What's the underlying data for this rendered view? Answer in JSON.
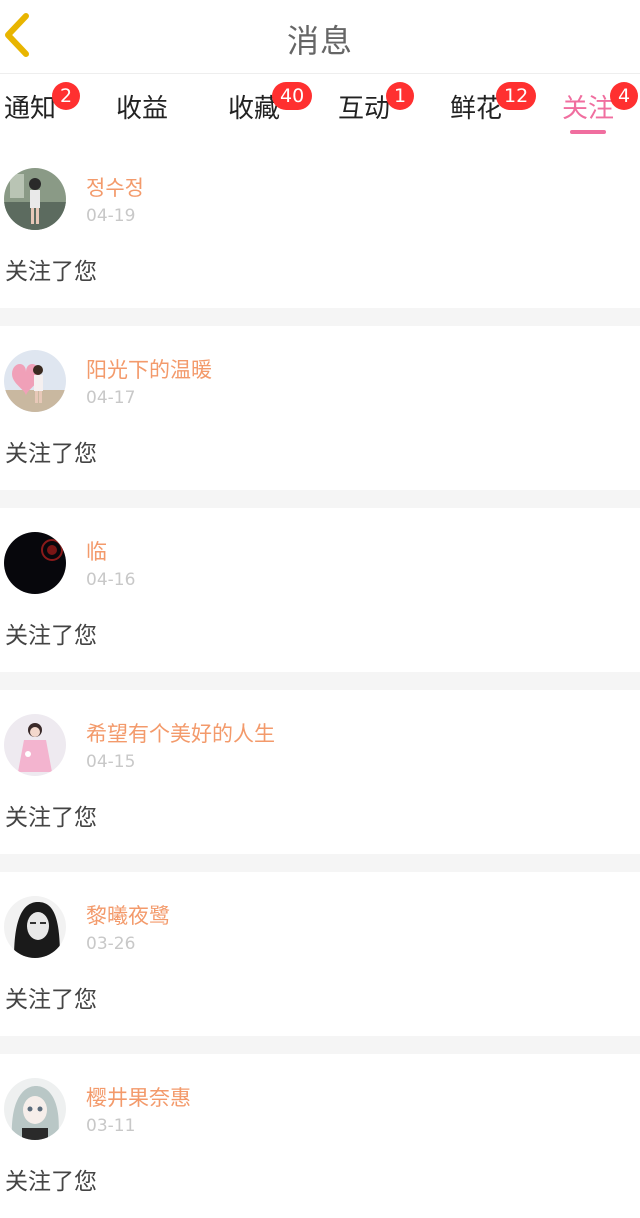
{
  "header": {
    "title": "消息",
    "back_icon": "chevron-left-icon",
    "back_color": "#e8b500"
  },
  "tabs": [
    {
      "label": "通知",
      "badge": "2"
    },
    {
      "label": "收益",
      "badge": ""
    },
    {
      "label": "收藏",
      "badge": "40"
    },
    {
      "label": "互动",
      "badge": "1"
    },
    {
      "label": "鲜花",
      "badge": "12"
    },
    {
      "label": "关注",
      "badge": "4",
      "active": true
    }
  ],
  "colors": {
    "accent": "#f06e9f",
    "badge": "#ff3030",
    "name": "#f39a6b"
  },
  "messages": [
    {
      "name": "정수정",
      "date": "04-19",
      "text": "关注了您"
    },
    {
      "name": "阳光下的温暖",
      "date": "04-17",
      "text": "关注了您"
    },
    {
      "name": "临",
      "date": "04-16",
      "text": "关注了您"
    },
    {
      "name": "希望有个美好的人生",
      "date": "04-15",
      "text": "关注了您"
    },
    {
      "name": "黎曦夜鹭",
      "date": "03-26",
      "text": "关注了您"
    },
    {
      "name": "樱井果奈惠",
      "date": "03-11",
      "text": "关注了您"
    }
  ]
}
